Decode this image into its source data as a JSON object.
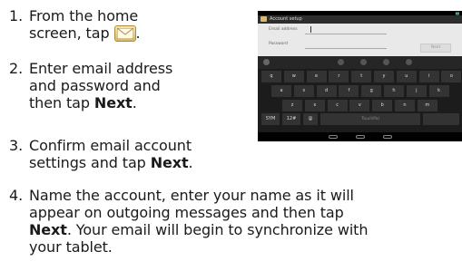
{
  "steps": [
    {
      "num": "1.",
      "lines": [
        "From the home",
        "screen, tap"
      ],
      "tail": "."
    },
    {
      "num": "2.",
      "lines": [
        "Enter email address",
        "and password and",
        "then tap "
      ],
      "bold": "Next",
      "tail": "."
    },
    {
      "num": "3.",
      "lines": [
        "Confirm email account",
        "settings and tap "
      ],
      "bold": "Next",
      "tail": "."
    },
    {
      "num": "4.",
      "lines": [
        "Name the account, enter your name as it will",
        "appear on outgoing messages and then tap"
      ],
      "bold": "Next",
      "after_bold": ". Your email will begin to synchronize with",
      "last": "your tablet."
    }
  ],
  "icons": {
    "email_app": "email-envelope-icon"
  },
  "tablet_screen": {
    "title": "Account setup",
    "email_label": "Email address",
    "password_label": "Password",
    "next_label": "Next",
    "keys_row1": [
      "q",
      "w",
      "e",
      "r",
      "t",
      "y",
      "u",
      "i",
      "o"
    ],
    "keys_row2": [
      "a",
      "s",
      "d",
      "f",
      "g",
      "h",
      "j",
      "k"
    ],
    "keys_row3": [
      "z",
      "x",
      "c",
      "v",
      "b",
      "n",
      "m"
    ],
    "sym_key": "SYM",
    "num_key": "12#",
    "at_key": "@",
    "space_label": "TouchPal"
  }
}
